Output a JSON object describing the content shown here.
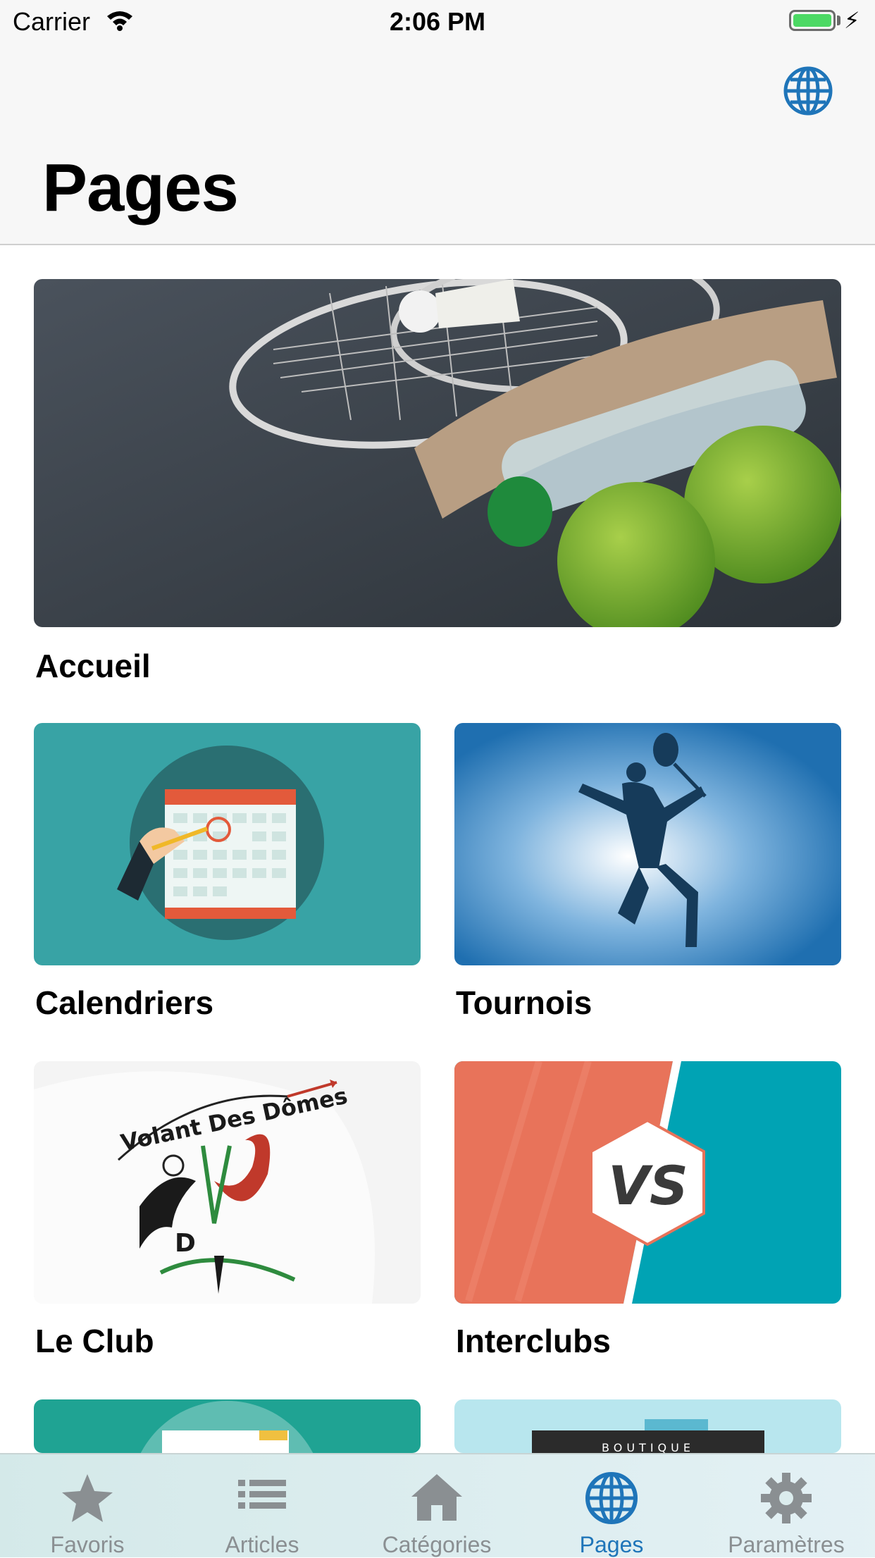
{
  "status_bar": {
    "carrier": "Carrier",
    "time": "2:06 PM"
  },
  "nav": {
    "title": "Pages",
    "globe_icon": "globe-icon"
  },
  "colors": {
    "accent": "#1f75b9",
    "inactive": "#8a8f92",
    "teal": "#38a3a5",
    "coral": "#e8735a"
  },
  "pages": [
    {
      "label": "Accueil",
      "image": "badminton-still-life"
    },
    {
      "label": "Calendriers",
      "image": "calendar-illustration"
    },
    {
      "label": "Tournois",
      "image": "badminton-player-silhouette"
    },
    {
      "label": "Le Club",
      "image": "club-logo"
    },
    {
      "label": "Interclubs",
      "image": "vs-illustration"
    },
    {
      "label": "",
      "image": "document-illustration"
    },
    {
      "label": "",
      "image": "boutique-illustration"
    }
  ],
  "club_logo_text": "Volant Des Dômes",
  "vs_text": "VS",
  "boutique_text": "BOUTIQUE",
  "tabbar": {
    "active": "Pages",
    "tabs": [
      {
        "label": "Favoris",
        "icon": "star-icon"
      },
      {
        "label": "Articles",
        "icon": "list-icon"
      },
      {
        "label": "Catégories",
        "icon": "house-icon"
      },
      {
        "label": "Pages",
        "icon": "globe-icon"
      },
      {
        "label": "Paramètres",
        "icon": "gear-icon"
      }
    ]
  }
}
